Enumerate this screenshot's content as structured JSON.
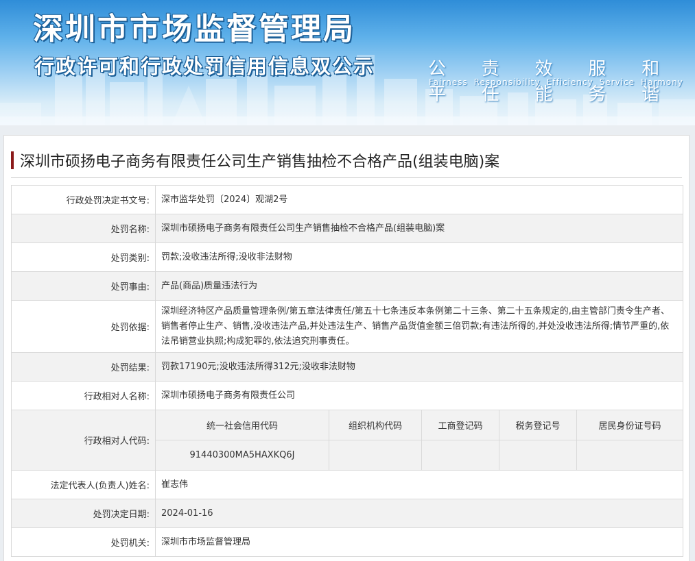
{
  "banner": {
    "title": "深圳市市场监督管理局",
    "subtitle": "行政许可和行政处罚信用信息双公示",
    "slogans": [
      {
        "cn": "公平",
        "en": "Fairness"
      },
      {
        "cn": "责任",
        "en": "Responsibility"
      },
      {
        "cn": "效能",
        "en": "Efficiency"
      },
      {
        "cn": "服务",
        "en": "Service"
      },
      {
        "cn": "和谐",
        "en": "Harmony"
      }
    ]
  },
  "case_title": "深圳市硕扬电子商务有限责任公司生产销售抽检不合格产品(组装电脑)案",
  "fields": {
    "decision_no": {
      "label": "行政处罚决定书文号:",
      "value": "深市监华处罚〔2024〕观湖2号"
    },
    "penalty_name": {
      "label": "处罚名称:",
      "value": "深圳市硕扬电子商务有限责任公司生产销售抽检不合格产品(组装电脑)案"
    },
    "penalty_type": {
      "label": "处罚类别:",
      "value": "罚款;没收违法所得;没收非法财物"
    },
    "penalty_reason": {
      "label": "处罚事由:",
      "value": "产品(商品)质量违法行为"
    },
    "penalty_basis": {
      "label": "处罚依据:",
      "value": "深圳经济特区产品质量管理条例/第五章法律责任/第五十七条违反本条例第二十三条、第二十五条规定的,由主管部门责令生产者、销售者停止生产、销售,没收违法产品,并处违法生产、销售产品货值金额三倍罚款;有违法所得的,并处没收违法所得;情节严重的,依法吊销营业执照;构成犯罪的,依法追究刑事责任。"
    },
    "penalty_result": {
      "label": "处罚结果:",
      "value": "罚款17190元;没收违法所得312元;没收非法财物"
    },
    "party_name": {
      "label": "行政相对人名称:",
      "value": "深圳市硕扬电子商务有限责任公司"
    },
    "party_code": {
      "label": "行政相对人代码:",
      "headers": [
        "统一社会信用代码",
        "组织机构代码",
        "工商登记码",
        "税务登记号",
        "居民身份证号码"
      ],
      "values": [
        "91440300MA5HAXKQ6J",
        "",
        "",
        "",
        ""
      ]
    },
    "legal_rep": {
      "label": "法定代表人(负责人)姓名:",
      "value": "崔志伟"
    },
    "decision_date": {
      "label": "处罚决定日期:",
      "value": "2024-01-16"
    },
    "authority": {
      "label": "处罚机关:",
      "value": "深圳市市场监督管理局"
    }
  },
  "colors": {
    "title_accent": "#8b1a1a",
    "banner_blue": "#2f8dd8",
    "row_alt": "#f2f2f2",
    "border": "#d9d9d9"
  }
}
